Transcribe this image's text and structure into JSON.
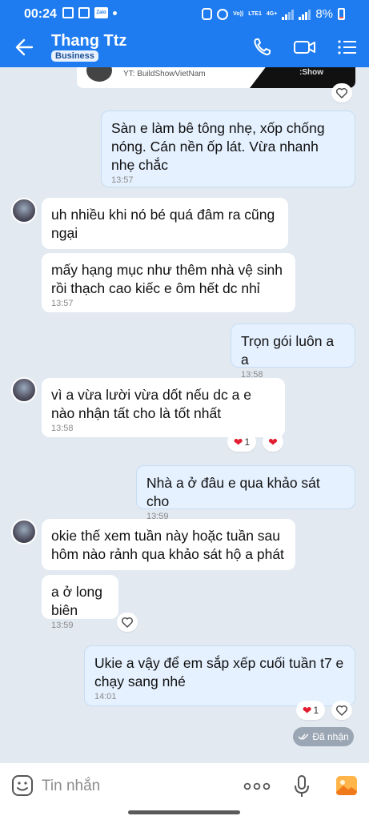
{
  "status_bar": {
    "time": "00:24",
    "network_left": "Vo))",
    "network_lte": "LTE1",
    "network_4g": "4G+",
    "battery": "8%"
  },
  "header": {
    "contact_name": "Thang Ttz",
    "badge": "Business"
  },
  "link_card": {
    "caption": "YT: BuildShowVietNam",
    "banner_text": ":Show"
  },
  "messages": [
    {
      "text": "Sàn e làm bê tông nhẹ, xốp chống nóng. Cán nền ốp lát. Vừa nhanh nhẹ chắc",
      "time": "13:57"
    },
    {
      "text": "uh nhiều khi nó bé quá đâm ra cũng ngại"
    },
    {
      "text": "mấy hạng mục như thêm nhà vệ sinh rồi thạch cao kiếc e ôm hết dc nhỉ",
      "time": "13:57"
    },
    {
      "text": "Trọn gói luôn a a",
      "time": "13:58"
    },
    {
      "text": "vì a vừa lười vừa dốt nếu dc a e nào nhận tất cho là tốt nhất",
      "time": "13:58",
      "reaction_count": "1"
    },
    {
      "text": "Nhà a ở đâu e qua khảo sát cho",
      "time": "13:59"
    },
    {
      "text": "okie thế xem tuần này hoặc tuần sau hôm nào rảnh qua khảo sát hộ a phát"
    },
    {
      "text": "a ở long biên",
      "time": "13:59"
    },
    {
      "text": "Ukie a vậy để em sắp xếp cuối tuần t7 e chạy sang nhé",
      "time": "14:01",
      "reaction_count": "1"
    }
  ],
  "delivery_status": "Đã nhận",
  "input": {
    "placeholder": "Tin nhắn"
  },
  "colors": {
    "header": "#1e7cf0",
    "background": "#e2e9f1",
    "outgoing_bubble": "#e5f1ff",
    "heart": "#e11d2f"
  }
}
